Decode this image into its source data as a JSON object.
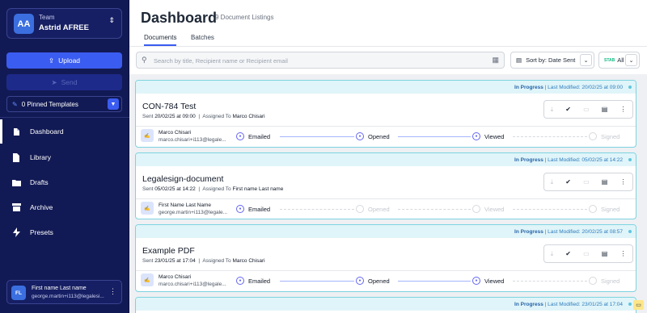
{
  "team": {
    "initials": "AA",
    "label": "Team",
    "name": "Astrid AFREE"
  },
  "actions": {
    "upload": "Upload",
    "send": "Send"
  },
  "pinned": {
    "label": "0 Pinned Templates"
  },
  "nav": [
    {
      "label": "Dashboard",
      "icon": "dashboard-icon",
      "active": true
    },
    {
      "label": "Library",
      "icon": "library-icon"
    },
    {
      "label": "Drafts",
      "icon": "drafts-icon"
    },
    {
      "label": "Archive",
      "icon": "archive-icon"
    },
    {
      "label": "Presets",
      "icon": "presets-icon"
    }
  ],
  "user": {
    "initials": "FL",
    "name": "First name Last name",
    "email": "george.martin+i113@legalesi..."
  },
  "page": {
    "title": "Dashboard",
    "subtitle": "9 Document Listings"
  },
  "tabs": [
    "Documents",
    "Batches"
  ],
  "search": {
    "placeholder": "Search by title, Recipient name or Recipient email"
  },
  "sort": {
    "label": "Sort by: Date Sent"
  },
  "filter": {
    "status_short": "STAB",
    "label": "All"
  },
  "colors": {
    "sidebar": "#121a55",
    "accent": "#3b5cf0",
    "card_border": "#7dd3e0",
    "status_bg": "#e0f5f9"
  },
  "documents": [
    {
      "status": "In Progress",
      "modified": "Last Modified: 20/02/25 at 09:00",
      "name": "CON-784 Test",
      "sent_prefix": "Sent",
      "sent_date": "20/02/25 at 09:00",
      "assigned_prefix": "Assigned To",
      "assigned_to": "Marco Chisari",
      "recipient_name": "Marco Chisari",
      "recipient_email": "marco.chisari+i113@legale...",
      "steps": [
        "Emailed",
        "Opened",
        "Viewed",
        "Signed"
      ]
    },
    {
      "status": "In Progress",
      "modified": "Last Modified: 05/02/25 at 14:22",
      "name": "Legalesign-document",
      "sent_prefix": "Sent",
      "sent_date": "05/02/25 at 14:22",
      "assigned_prefix": "Assigned To",
      "assigned_to": "First name Last name",
      "recipient_name": "First Name Last Name",
      "recipient_email": "george.martin+i113@legale...",
      "steps": [
        "Emailed",
        "Opened",
        "Viewed",
        "Signed"
      ]
    },
    {
      "status": "In Progress",
      "modified": "Last Modified: 20/02/25 at 08:57",
      "name": "Example PDF",
      "sent_prefix": "Sent",
      "sent_date": "23/01/25 at 17:04",
      "assigned_prefix": "Assigned To",
      "assigned_to": "Marco Chisari",
      "recipient_name": "Marco Chisari",
      "recipient_email": "marco.chisari+i113@legale...",
      "steps": [
        "Emailed",
        "Opened",
        "Viewed",
        "Signed"
      ]
    },
    {
      "status": "In Progress",
      "modified": "Last Modified: 23/01/25 at 17:04"
    }
  ]
}
